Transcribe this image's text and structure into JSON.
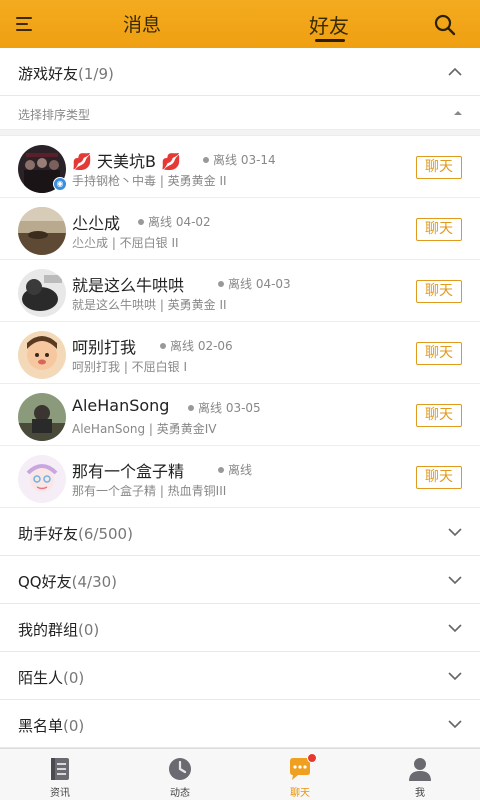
{
  "header": {
    "tab_messages": "消息",
    "tab_friends": "好友"
  },
  "game_friends": {
    "title": "游戏好友",
    "count": "(1/9)",
    "sort_label": "选择排序类型",
    "friends": [
      {
        "name": "天美坑B",
        "status": "离线 03-14",
        "detail": "手持钢枪丶中毒 | 英勇黄金 II",
        "chat": "聊天"
      },
      {
        "name": "尐尐成",
        "status": "离线 04-02",
        "detail": "尐尐成 | 不屈白银 II",
        "chat": "聊天"
      },
      {
        "name": "就是这么牛哄哄",
        "status": "离线 04-03",
        "detail": "就是这么牛哄哄 | 英勇黄金 II",
        "chat": "聊天"
      },
      {
        "name": "呵别打我",
        "status": "离线 02-06",
        "detail": "呵别打我 | 不屈白银 I",
        "chat": "聊天"
      },
      {
        "name": "AleHanSong",
        "status": "离线 03-05",
        "detail": "AleHanSong | 英勇黄金IV",
        "chat": "聊天"
      },
      {
        "name": "那有一个盒子精",
        "status": "离线",
        "detail": "那有一个盒子精 | 热血青铜III",
        "chat": "聊天"
      }
    ]
  },
  "sections": [
    {
      "title": "助手好友",
      "count": "(6/500)"
    },
    {
      "title": "QQ好友",
      "count": "(4/30)"
    },
    {
      "title": "我的群组",
      "count": "(0)"
    },
    {
      "title": "陌生人",
      "count": "(0)"
    },
    {
      "title": "黑名单",
      "count": "(0)"
    }
  ],
  "bottom_nav": [
    {
      "label": "资讯"
    },
    {
      "label": "动态"
    },
    {
      "label": "聊天"
    },
    {
      "label": "我"
    }
  ],
  "colors": {
    "header": "#f2a318",
    "accent": "#e09a1e",
    "notification": "#e63a2e"
  }
}
